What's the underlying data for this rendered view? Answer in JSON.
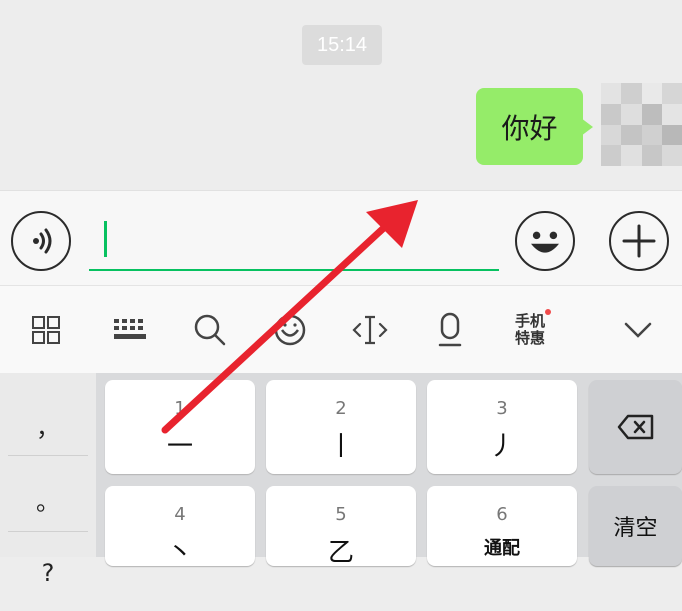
{
  "chat": {
    "timestamp": "15:14",
    "messages": [
      {
        "text": "你好",
        "from": "self"
      }
    ]
  },
  "input_bar": {
    "voice_icon": "voice-input-icon",
    "text_value": "",
    "emoji_icon": "emoji-icon",
    "more_icon": "plus-icon"
  },
  "toolbar": {
    "items": [
      "grid-menu-icon",
      "keyboard-icon",
      "search-icon",
      "emoji-face-icon",
      "cursor-move-icon",
      "microphone-icon",
      "phone-deals",
      "collapse-chevron-icon"
    ],
    "promo_label_line1": "手机",
    "promo_label_line2": "特惠"
  },
  "keyboard": {
    "side_symbols": [
      "，",
      "。",
      "?"
    ],
    "keys": [
      {
        "num": "1",
        "main": "一"
      },
      {
        "num": "2",
        "main": "丨"
      },
      {
        "num": "3",
        "main": "丿"
      },
      {
        "num": "4",
        "main": "丶"
      },
      {
        "num": "5",
        "main": "乙"
      },
      {
        "num": "6",
        "main": "通配"
      }
    ],
    "delete_icon": "backspace-icon",
    "clear_label": "清空"
  },
  "colors": {
    "bubble": "#95ec69",
    "accent": "#07c160",
    "annotation_arrow": "#e8232e"
  }
}
